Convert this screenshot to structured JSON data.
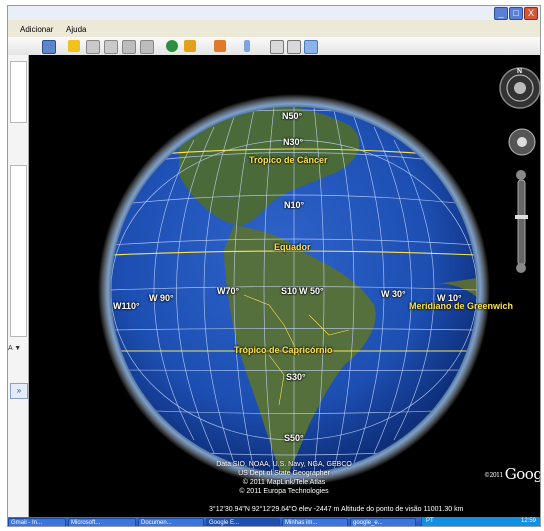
{
  "window": {
    "min": "_",
    "max": "□",
    "close": "X"
  },
  "menu": {
    "items": [
      "Adicionar",
      "Ajuda"
    ]
  },
  "toolbar": {
    "icons": [
      "sidebar-icon",
      "placemark-icon",
      "polygon-icon",
      "path-icon",
      "image-overlay-icon",
      "record-tour-icon",
      "historical-imagery-icon",
      "sun-icon",
      "planets-icon",
      "ruler-icon",
      "email-icon",
      "print-icon",
      "view-in-maps-icon"
    ]
  },
  "leftpanel": {
    "expand": "»",
    "arrow": "A ▼"
  },
  "globe": {
    "labels": {
      "n50": "N50°",
      "n30": "N30°",
      "tropic_cancer": "Trópico de Câncer",
      "n10": "N10°",
      "equator": "Equador",
      "w110": "W110°",
      "w90": "W 90°",
      "w70": "W70°",
      "s10": "S10",
      "w50": "W 50°",
      "w30": "W 30°",
      "w10": "W 10°",
      "greenwich": "Meridiano de Greenwich",
      "tropic_capricorn": "Trópico de Capricórnio",
      "s30": "S30°",
      "s50": "S50°"
    }
  },
  "credits": {
    "line1": "Data SIO, NOAA, U.S. Navy, NGA, GEBCO",
    "line2": "US Dept of State Geographer",
    "line3": "© 2011 MapLink/Tele Atlas",
    "line4": "© 2011 Europa Technologies"
  },
  "logo": {
    "year": "©2011",
    "text": "Google"
  },
  "status": {
    "text": "3°12'30.94\"N  92°12'29.64\"O  elev -2447 m  Altitude do ponto de visão 11001.30 km"
  },
  "taskbar": {
    "tasks": [
      "Gmail - In...",
      "Microsoft...",
      "Documen...",
      "Google E...",
      "Minhas im...",
      "google_e..."
    ],
    "active_index": 3,
    "lang": "PT",
    "clock": "12:59"
  },
  "colors": {
    "ocean": "#1d4fb3",
    "grid": "#c8d8ff",
    "tropic": "#ffe34d",
    "land": "#4d6b3a"
  }
}
